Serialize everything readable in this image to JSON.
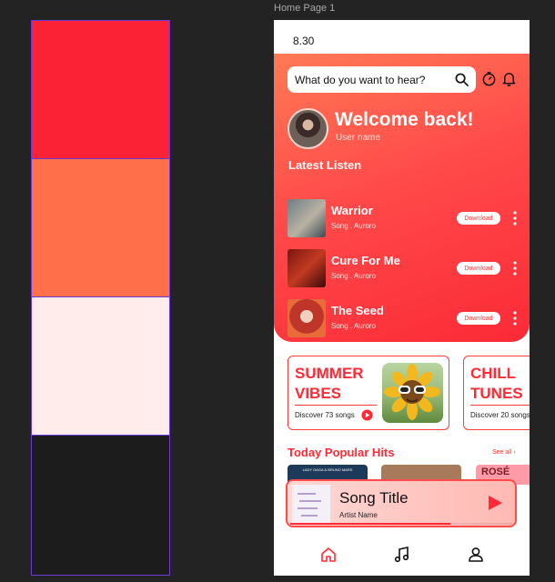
{
  "palette": [
    "#fb2235",
    "#ff6f4a",
    "#ffeceb",
    "#1c1c1c"
  ],
  "frame_label": "Home Page 1",
  "status": {
    "time": "8.30"
  },
  "search": {
    "placeholder": "What do you want to hear?",
    "icon": "search-icon"
  },
  "header_icons": [
    "timer-icon",
    "bell-icon"
  ],
  "user": {
    "welcome": "Welcome back!",
    "name": "User name"
  },
  "latest": {
    "title": "Latest Listen",
    "songs": [
      {
        "title": "Warrior",
        "meta": "Song . Auroro",
        "download_label": "Download"
      },
      {
        "title": "Cure For Me",
        "meta": "Song . Auroro",
        "download_label": "Download"
      },
      {
        "title": "The Seed",
        "meta": "Song . Auroro",
        "download_label": "Download"
      }
    ]
  },
  "cards": [
    {
      "title_line1": "SUMMER",
      "title_line2": "VIBES",
      "subtitle": "Discover 73 songs"
    },
    {
      "title_line1": "CHILL",
      "title_line2": "TUNES",
      "subtitle": "Discover 20 songs"
    }
  ],
  "popular": {
    "title": "Today Popular Hits",
    "see_all": "See all",
    "peek_labels": [
      "LADY GAGA & BRUNO MARS",
      "ROSÉ"
    ]
  },
  "player": {
    "title": "Song Title",
    "artist": "Artist Name",
    "progress": 0.72
  },
  "nav": [
    "home-icon",
    "music-note-icon",
    "profile-icon"
  ],
  "colors": {
    "primary": "#fb2235",
    "secondary": "#ff6f4a",
    "light": "#ffeceb",
    "dark": "#1c1c1c"
  }
}
